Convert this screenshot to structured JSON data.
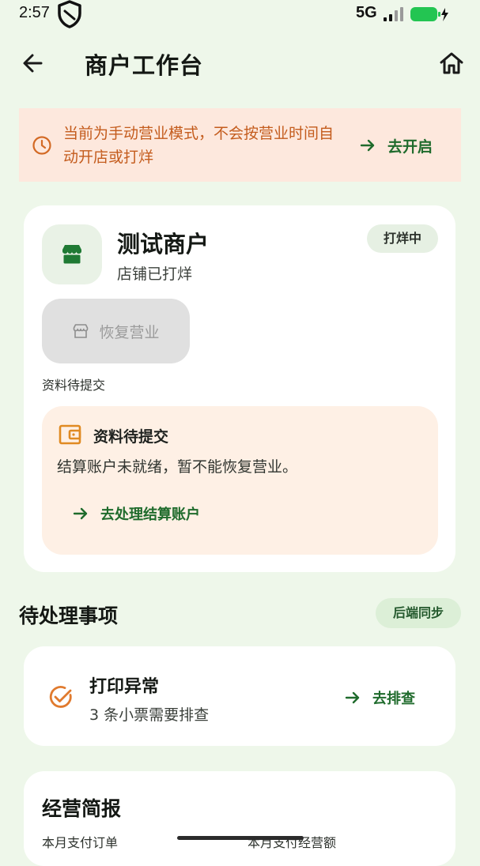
{
  "status_bar": {
    "time": "2:57",
    "network": "5G",
    "icons": [
      "shield-icon",
      "signal-icon",
      "battery-charging-icon"
    ],
    "battery_color": "#23c552"
  },
  "app_bar": {
    "title": "商户工作台",
    "icons": [
      "back-arrow-icon",
      "home-icon"
    ]
  },
  "notice": {
    "text": "当前为手动营业模式，不会按营业时间自动开店或打烊",
    "action_label": "去开启",
    "icon": "clock-icon",
    "text_color": "#c45c1d",
    "background": "#fde8dd"
  },
  "store": {
    "name": "测试商户",
    "status_text": "店铺已打烊",
    "badge": "打烊中",
    "icon": "storefront-icon",
    "resume_button_label": "恢复营业",
    "resume_button_icon": "storefront-outline-icon",
    "pending_caption": "资料待提交",
    "pending_panel": {
      "icon": "wallet-icon",
      "title": "资料待提交",
      "description": "结算账户未就绪，暂不能恢复营业。",
      "action_label": "去处理结算账户"
    }
  },
  "todos": {
    "section_title": "待处理事项",
    "sync_badge": "后端同步",
    "items": [
      {
        "icon": "check-circle-icon",
        "title": "打印异常",
        "description": "3 条小票需要排查",
        "action_label": "去排查"
      }
    ]
  },
  "summary": {
    "title": "经营简报",
    "labels": [
      "本月支付订单",
      "本月支付经营额"
    ]
  },
  "colors": {
    "accent_green": "#1f6b2c",
    "background": "#eef7ea",
    "warning_orange": "#e07a2e"
  }
}
